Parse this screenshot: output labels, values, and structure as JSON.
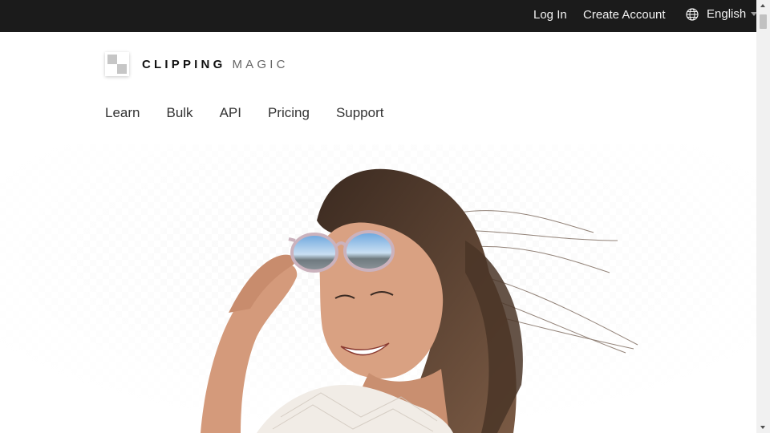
{
  "topbar": {
    "login": "Log In",
    "create_account": "Create Account",
    "language": "English"
  },
  "logo": {
    "bold": "CLIPPING",
    "light": "MAGIC"
  },
  "nav": {
    "items": [
      "Learn",
      "Bulk",
      "API",
      "Pricing",
      "Support"
    ]
  },
  "icons": {
    "globe": "globe-icon",
    "caret": "chevron-down-icon"
  },
  "colors": {
    "topbar_bg": "#1b1b1b",
    "page_bg": "#ffffff"
  }
}
